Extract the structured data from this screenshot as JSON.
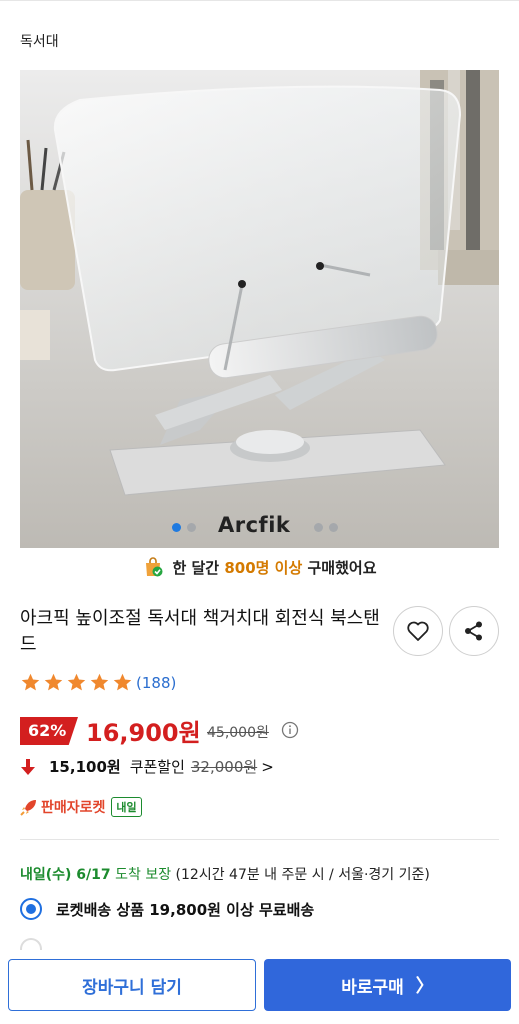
{
  "breadcrumb": "독서대",
  "hero": {
    "brand": "Arcfik",
    "total_slides": 4,
    "active_slide": 0
  },
  "buyers": {
    "prefix": "한 달간",
    "count": "800명 이상",
    "suffix": "구매했어요"
  },
  "product": {
    "title": "아크픽 높이조절 독서대 책거치대 회전식 북스탠드"
  },
  "icons": {
    "heart": "heart-icon",
    "share": "share-icon",
    "info": "info-icon",
    "bag": "shopping-bag-icon",
    "rocket": "rocket-icon"
  },
  "rating": {
    "stars": 5,
    "max": 5,
    "review_count": "(188)"
  },
  "price": {
    "discount": "62%",
    "sale": "16,900원",
    "original": "45,000원"
  },
  "coupon": {
    "price": "15,100원",
    "label": "쿠폰할인",
    "original": "32,000원",
    "chevron": ">"
  },
  "rocket": {
    "label": "판매자로켓",
    "tag": "내일"
  },
  "delivery": {
    "date": "내일(수) 6/17",
    "guarantee": "도착 보장",
    "condition": "(12시간 47분 내 주문 시 / 서울·경기 기준)"
  },
  "shipping_option": {
    "label": "로켓배송 상품 19,800원 이상 무료배송"
  },
  "buttons": {
    "cart": "장바구니 담기",
    "buy": "바로구매",
    "buy_chevron": "〉"
  },
  "colors": {
    "accent": "#3067db",
    "sale_red": "#d31f1f",
    "delivery_green": "#1c8b2e",
    "highlight_orange": "#d47a00",
    "star": "#f0882e"
  }
}
